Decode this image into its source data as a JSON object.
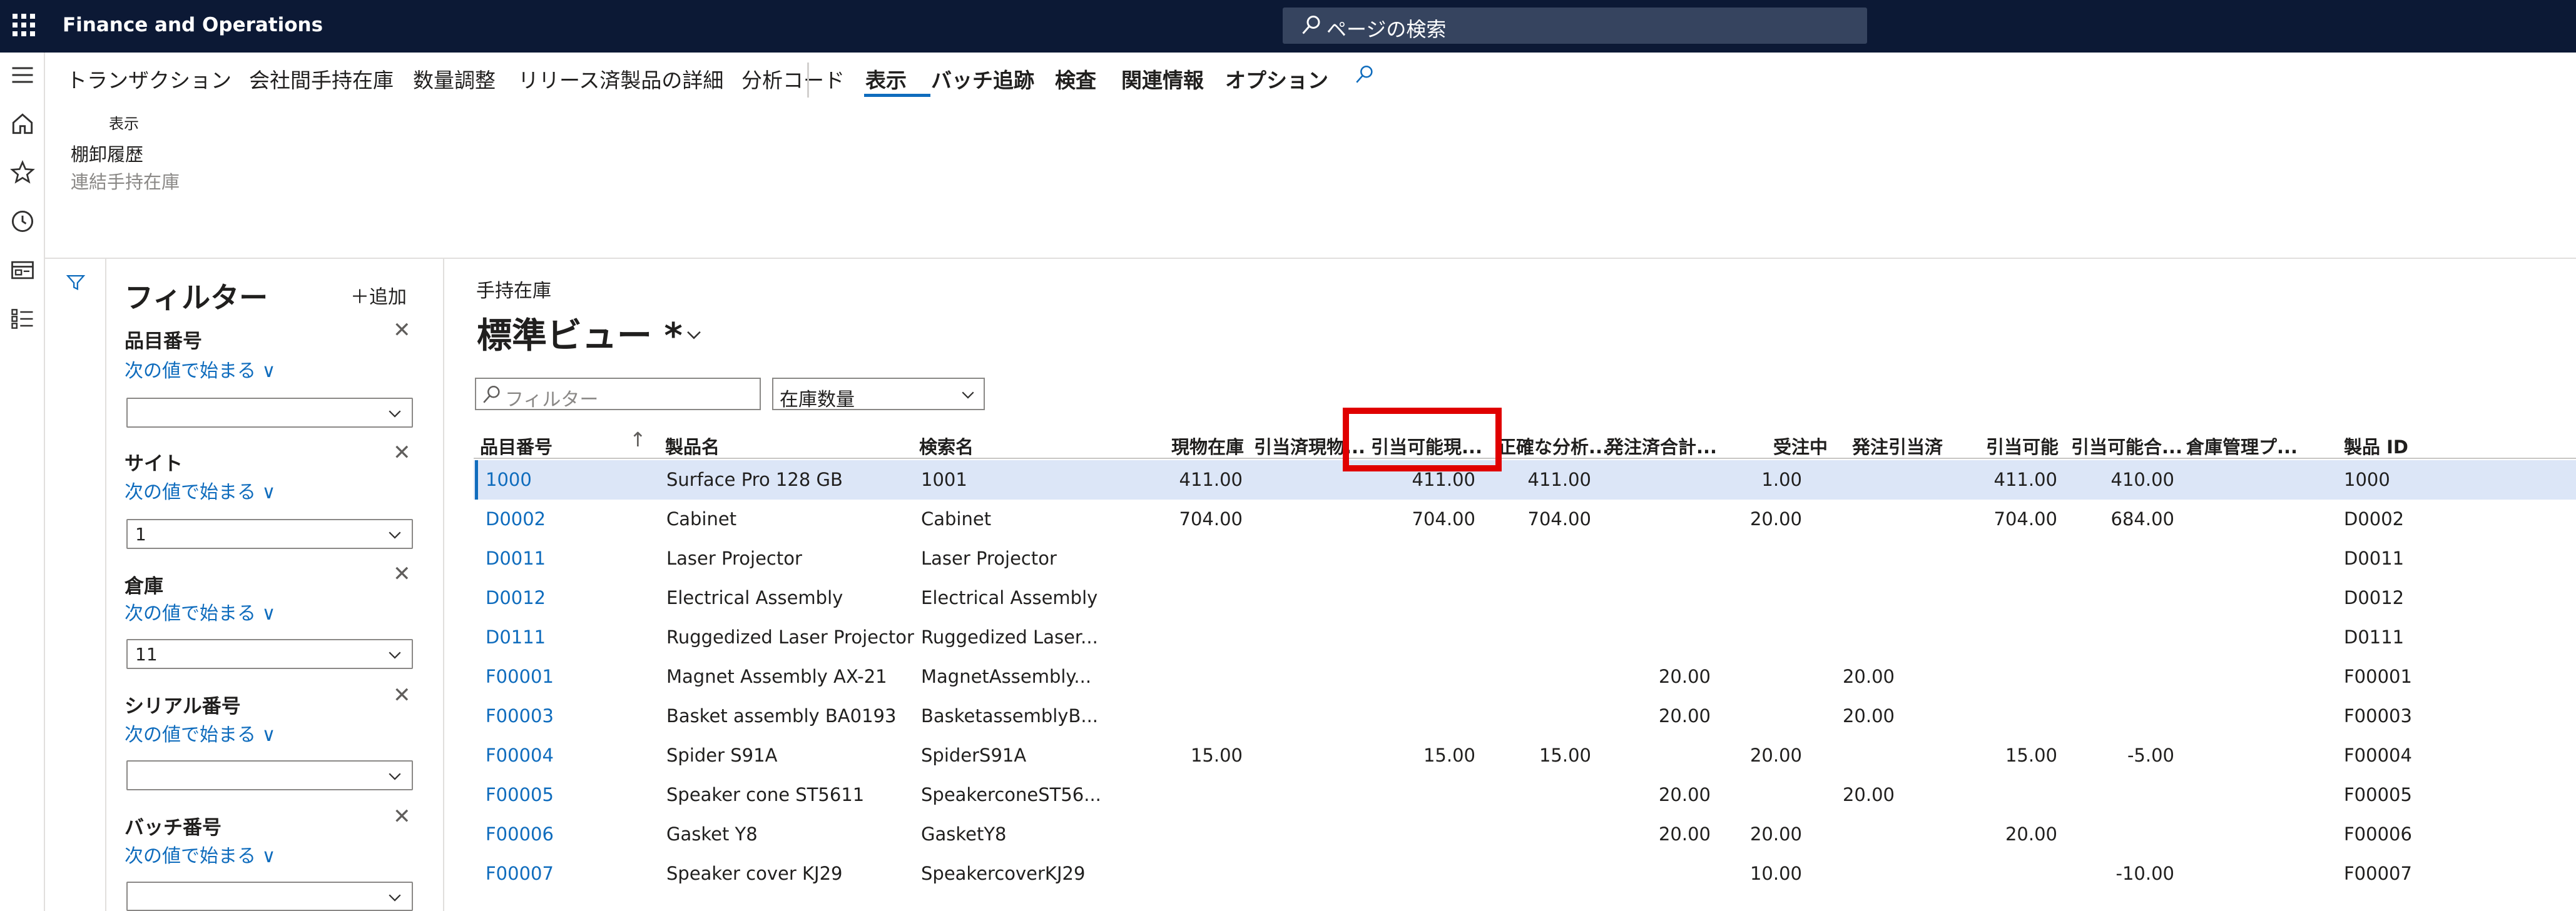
{
  "app": {
    "title": "Finance and Operations",
    "search_placeholder": "ページの検索"
  },
  "rail": {
    "icons": [
      "hamburger-icon",
      "home-icon",
      "star-icon",
      "clock-icon",
      "workspace-icon",
      "list-icon"
    ]
  },
  "action_pane": {
    "tabs": [
      "トランザクション",
      "会社間手持在庫",
      "数量調整",
      "リリース済製品の詳細",
      "分析コード",
      "表示",
      "バッチ追跡",
      "検査",
      "関連情報",
      "オプション"
    ],
    "active_tab": "表示",
    "group_label": "表示",
    "commands": [
      "棚卸履歴",
      "連結手持在庫"
    ]
  },
  "filter_pane": {
    "title": "フィルター",
    "add_label": "＋追加",
    "filters": [
      {
        "label": "品目番号",
        "operator": "次の値で始まる",
        "value": ""
      },
      {
        "label": "サイト",
        "operator": "次の値で始まる",
        "value": "1"
      },
      {
        "label": "倉庫",
        "operator": "次の値で始まる",
        "value": "11"
      },
      {
        "label": "シリアル番号",
        "operator": "次の値で始まる",
        "value": ""
      },
      {
        "label": "バッチ番号",
        "operator": "次の値で始まる",
        "value": ""
      }
    ]
  },
  "main": {
    "breadcrumb": "手持在庫",
    "view_title": "標準ビュー *",
    "grid_filter_placeholder": "フィルター",
    "quantity_select": "在庫数量",
    "columns": [
      "品目番号",
      "製品名",
      "検索名",
      "現物在庫",
      "引当済現物...",
      "引当可能現...",
      "正確な分析...",
      "発注済合計...",
      "受注中",
      "発注引当済",
      "引当可能",
      "引当可能合...",
      "倉庫管理プ...",
      "製品 ID"
    ],
    "rows": [
      [
        "1000",
        "Surface Pro 128 GB",
        "1001",
        "411.00",
        "",
        "411.00",
        "411.00",
        "",
        "1.00",
        "",
        "411.00",
        "410.00",
        "",
        "1000"
      ],
      [
        "D0002",
        "Cabinet",
        "Cabinet",
        "704.00",
        "",
        "704.00",
        "704.00",
        "",
        "20.00",
        "",
        "704.00",
        "684.00",
        "",
        "D0002"
      ],
      [
        "D0011",
        "Laser Projector",
        "Laser Projector",
        "",
        "",
        "",
        "",
        "",
        "",
        "",
        "",
        "",
        "",
        "D0011"
      ],
      [
        "D0012",
        "Electrical Assembly",
        "Electrical Assembly",
        "",
        "",
        "",
        "",
        "",
        "",
        "",
        "",
        "",
        "",
        "D0012"
      ],
      [
        "D0111",
        "Ruggedized Laser Projector",
        "Ruggedized Laser...",
        "",
        "",
        "",
        "",
        "",
        "",
        "",
        "",
        "",
        "",
        "D0111"
      ],
      [
        "F00001",
        "Magnet Assembly AX-21",
        "MagnetAssembly...",
        "",
        "",
        "",
        "",
        "20.00",
        "",
        "20.00",
        "",
        "",
        "",
        "F00001"
      ],
      [
        "F00003",
        "Basket assembly BA0193",
        "BasketassemblyB...",
        "",
        "",
        "",
        "",
        "20.00",
        "",
        "20.00",
        "",
        "",
        "",
        "F00003"
      ],
      [
        "F00004",
        "Spider S91A",
        "SpiderS91A",
        "15.00",
        "",
        "15.00",
        "15.00",
        "",
        "20.00",
        "",
        "15.00",
        "-5.00",
        "",
        "F00004"
      ],
      [
        "F00005",
        "Speaker cone ST5611",
        "SpeakerconeST56...",
        "",
        "",
        "",
        "",
        "20.00",
        "",
        "20.00",
        "",
        "",
        "",
        "F00005"
      ],
      [
        "F00006",
        "Gasket Y8",
        "GasketY8",
        "",
        "",
        "",
        "",
        "20.00",
        "20.00",
        "",
        "20.00",
        "",
        "",
        "F00006"
      ],
      [
        "F00007",
        "Speaker cover KJ29",
        "SpeakercoverKJ29",
        "",
        "",
        "",
        "",
        "",
        "10.00",
        "",
        "",
        "-10.00",
        "",
        "F00007"
      ]
    ]
  },
  "colors": {
    "topbar": "#0c1935",
    "accent": "#0f6cbd",
    "highlight": "#e00000",
    "selected_row": "#dce6f7"
  }
}
